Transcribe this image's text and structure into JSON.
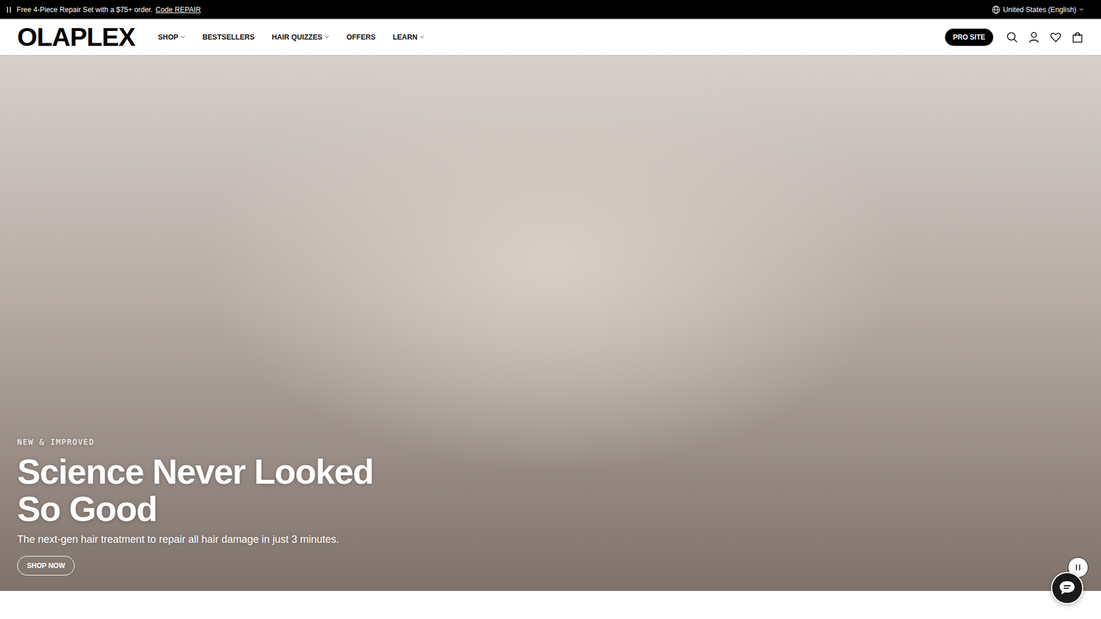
{
  "announcement": {
    "text": "Free 4-Piece Repair Set with a $75+ order.",
    "link": "Code REPAIR",
    "playing": true
  },
  "locale": "United States (English)",
  "logo": "OLAPLEX",
  "nav": [
    {
      "label": "SHOP",
      "has_menu": true
    },
    {
      "label": "BESTSELLERS",
      "has_menu": false
    },
    {
      "label": "HAIR QUIZZES",
      "has_menu": true
    },
    {
      "label": "OFFERS",
      "has_menu": false
    },
    {
      "label": "LEARN",
      "has_menu": true
    }
  ],
  "pro_site": "PRO SITE",
  "hero": {
    "eyebrow": "NEW & IMPROVED",
    "title_lines": [
      "Science Never Looked",
      "So Good"
    ],
    "subtitle": "The next-gen hair treatment to repair all hair damage in just 3 minutes.",
    "button": "SHOP NOW",
    "video_playing": true
  }
}
